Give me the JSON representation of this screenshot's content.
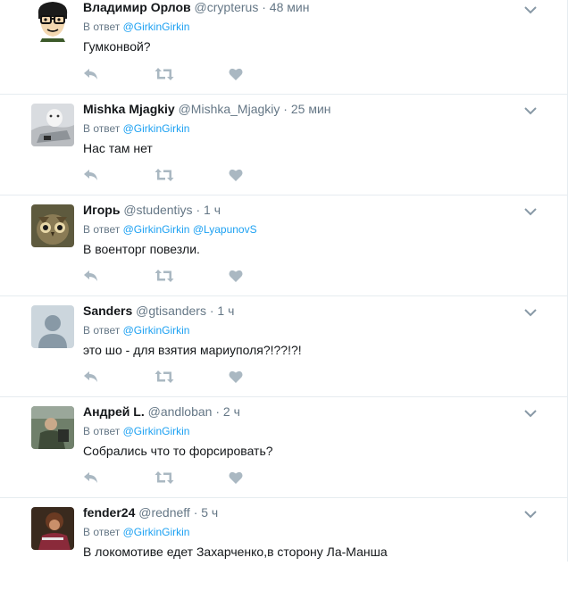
{
  "reply_prefix": "В ответ",
  "tweets": [
    {
      "name": "Владимир Орлов",
      "handle": "@crypterus",
      "separator": "·",
      "time": "48 мин",
      "mentions": [
        "@GirkinGirkin"
      ],
      "text": "Гумконвой?",
      "avatar_icon": "cartoon-glasses-avatar"
    },
    {
      "name": "Mishka Mjagkiy",
      "handle": "@Mishka_Mjagkiy",
      "separator": "·",
      "time": "25 мин",
      "mentions": [
        "@GirkinGirkin"
      ],
      "text": "Нас там нет",
      "avatar_icon": "photo-avatar"
    },
    {
      "name": "Игорь",
      "handle": "@studentiys",
      "separator": "·",
      "time": "1 ч",
      "mentions": [
        "@GirkinGirkin",
        "@LyapunovS"
      ],
      "text": "В военторг повезли.",
      "avatar_icon": "owl-avatar"
    },
    {
      "name": "Sanders",
      "handle": "@gtisanders",
      "separator": "·",
      "time": "1 ч",
      "mentions": [
        "@GirkinGirkin"
      ],
      "text": "это шо - для взятия мариуполя?!??!?!",
      "avatar_icon": "default-egg-avatar"
    },
    {
      "name": "Андрей L.",
      "handle": "@andloban",
      "separator": "·",
      "time": "2 ч",
      "mentions": [
        "@GirkinGirkin"
      ],
      "text": "Собрались что то форсировать?",
      "avatar_icon": "photo-avatar"
    },
    {
      "name": "fender24",
      "handle": "@redneff",
      "separator": "·",
      "time": "5 ч",
      "mentions": [
        "@GirkinGirkin"
      ],
      "text": "В локомотиве едет Захарченко,в сторону Ла-Манша",
      "avatar_icon": "photo-avatar"
    }
  ],
  "colors": {
    "link": "#1da1f2",
    "meta": "#657786",
    "icon": "#aab8c2",
    "border": "#e6ecf0"
  }
}
